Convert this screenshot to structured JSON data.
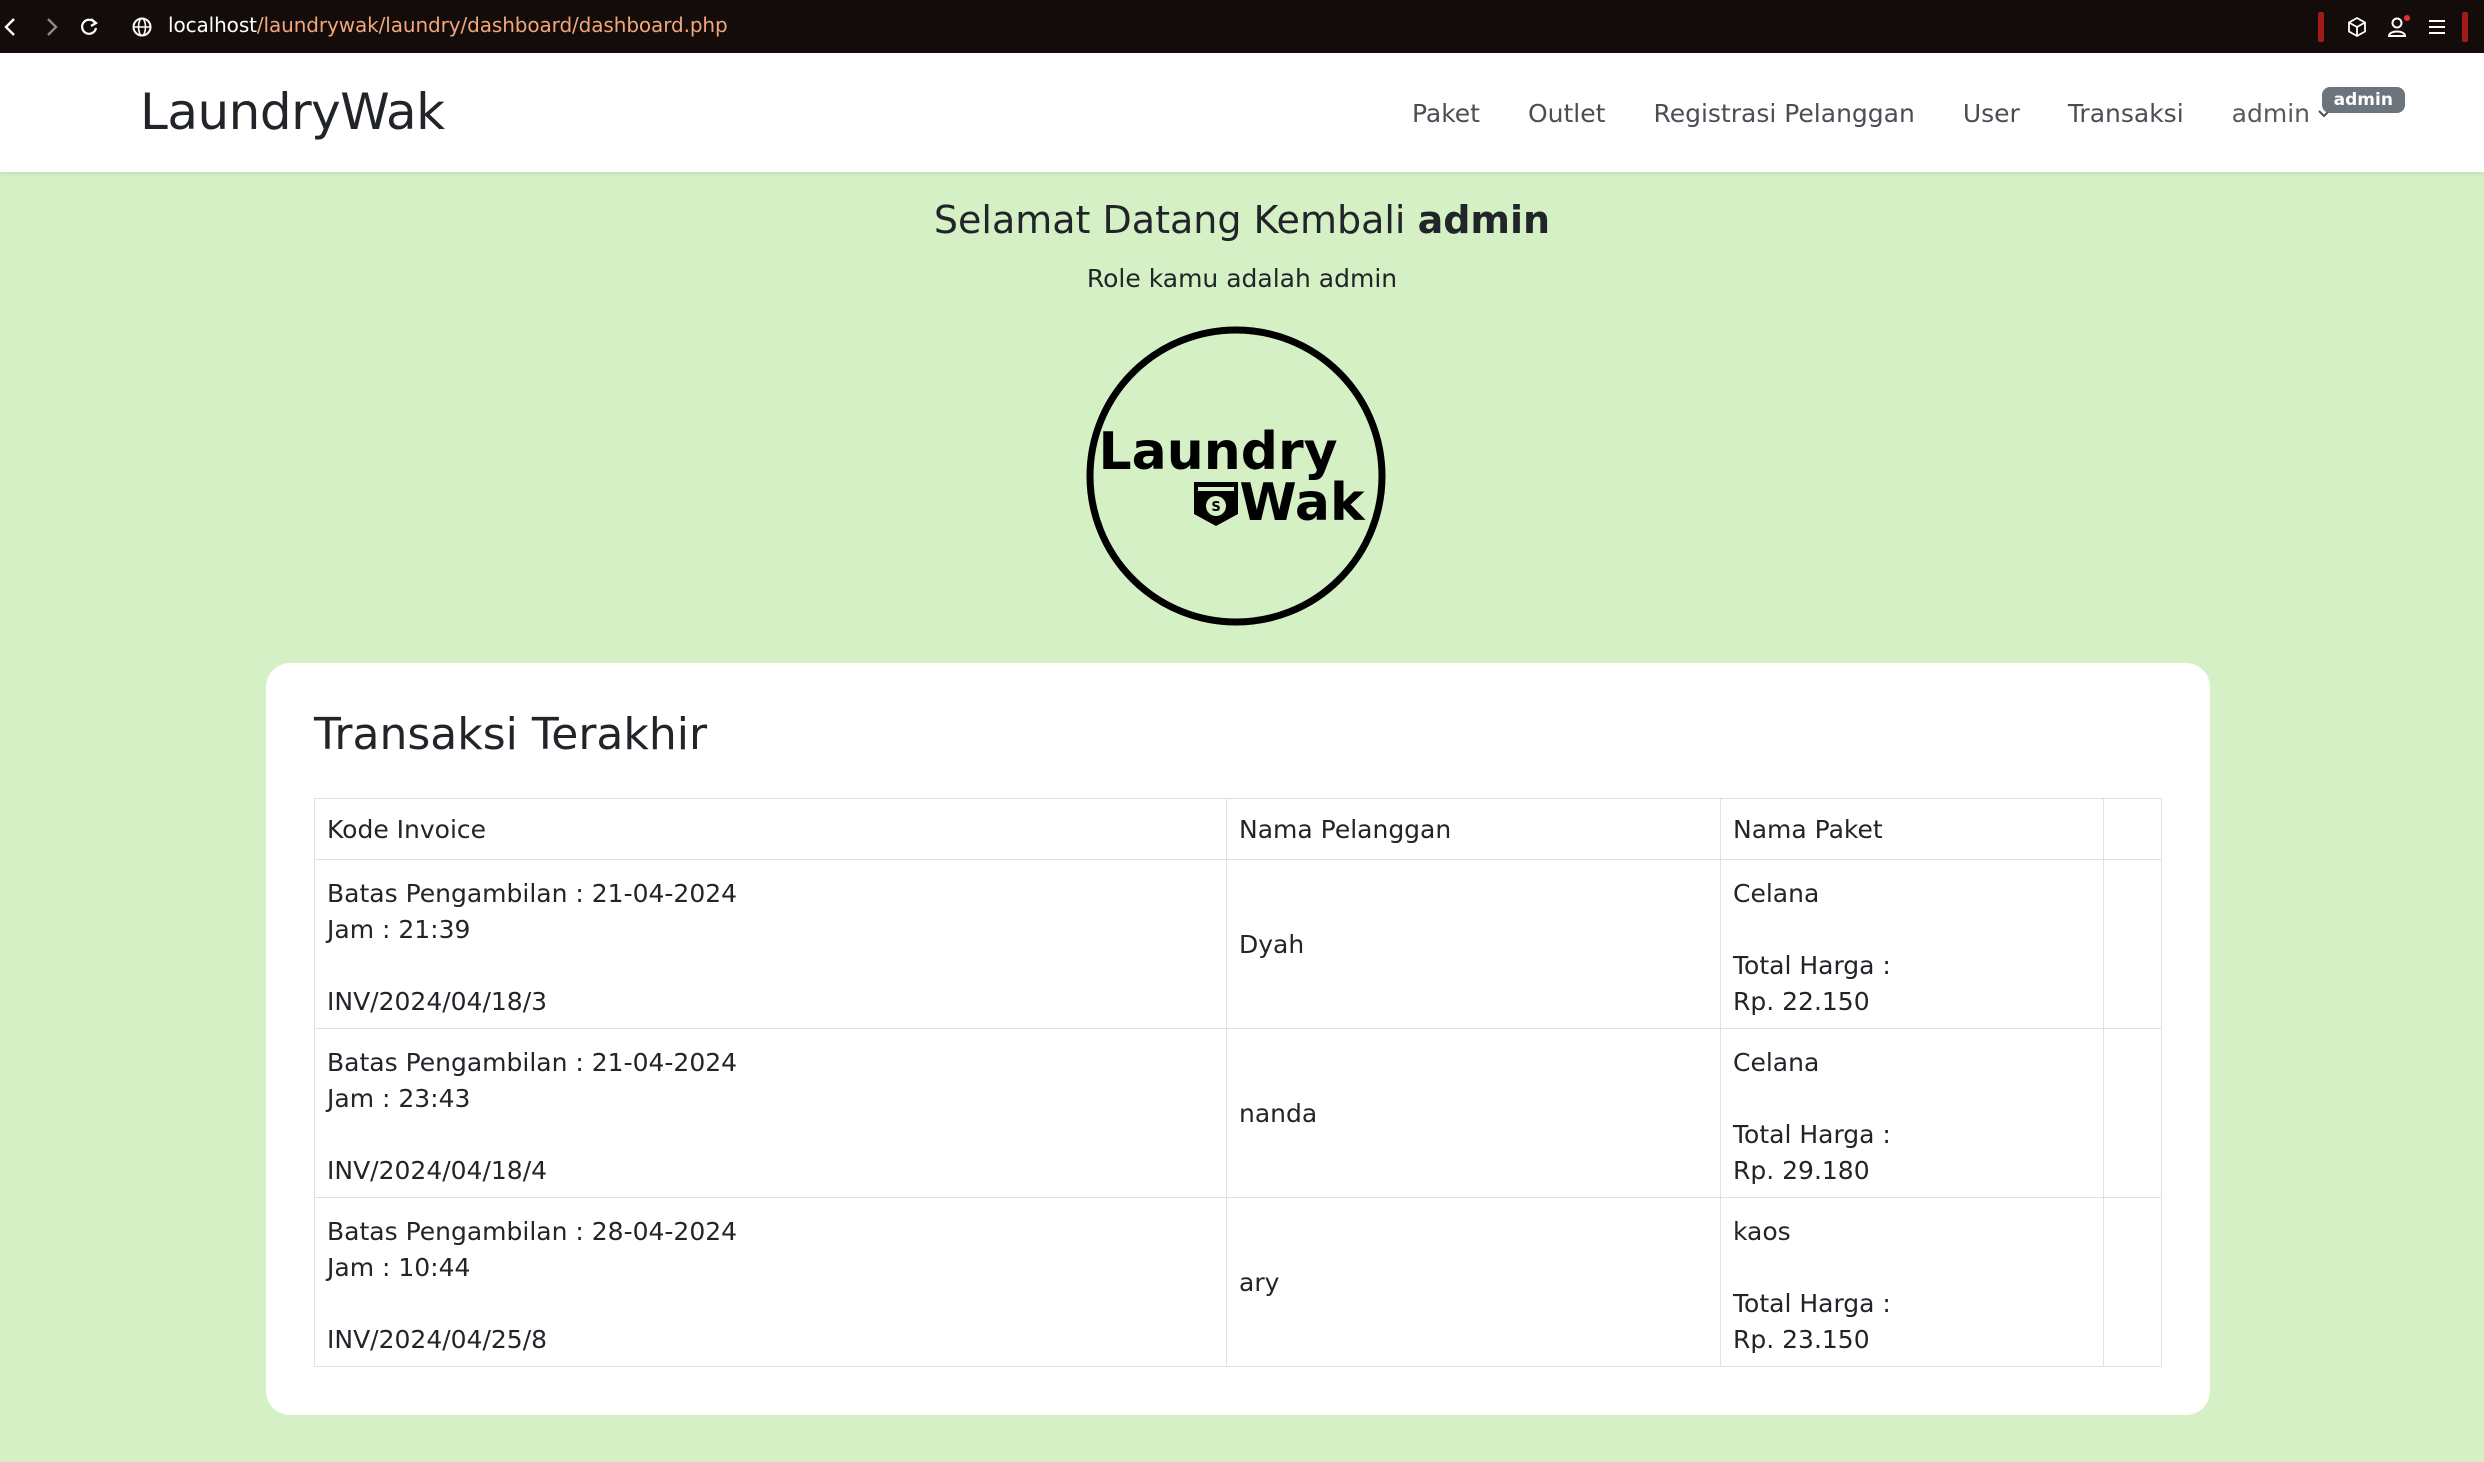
{
  "browser": {
    "url_host": "localhost",
    "url_path": "/laundrywak/laundry/dashboard/dashboard.php"
  },
  "navbar": {
    "brand": "LaundryWak",
    "menu": [
      "Paket",
      "Outlet",
      "Registrasi Pelanggan",
      "User",
      "Transaksi"
    ],
    "user_label": "admin",
    "badge": "admin"
  },
  "welcome": {
    "greeting": "Selamat Datang Kembali",
    "username": "admin",
    "role_text": "Role kamu adalah admin"
  },
  "logo": {
    "line1": "Laundry",
    "line2": "Wak",
    "mark": "S"
  },
  "transactions": {
    "title": "Transaksi Terakhir",
    "headers": [
      "Kode Invoice",
      "Nama Pelanggan",
      "Nama Paket",
      ""
    ],
    "rows": [
      {
        "batas": "Batas Pengambilan : 21-04-2024",
        "jam": "Jam : 21:39",
        "invoice": "INV/2024/04/18/3",
        "pelanggan": "Dyah",
        "paket": "Celana",
        "total_label": "Total Harga :",
        "total": "Rp. 22.150"
      },
      {
        "batas": "Batas Pengambilan : 21-04-2024",
        "jam": "Jam : 23:43",
        "invoice": "INV/2024/04/18/4",
        "pelanggan": "nanda",
        "paket": "Celana",
        "total_label": "Total Harga :",
        "total": "Rp. 29.180"
      },
      {
        "batas": "Batas Pengambilan : 28-04-2024",
        "jam": "Jam : 10:44",
        "invoice": "INV/2024/04/25/8",
        "pelanggan": "ary",
        "paket": "kaos",
        "total_label": "Total Harga :",
        "total": "Rp. 23.150"
      }
    ]
  },
  "icons": {
    "back": "arrow-left-icon",
    "forward": "arrow-right-icon",
    "reload": "reload-icon",
    "site": "globe-icon",
    "extensions": "cube-icon",
    "profile": "person-icon",
    "menu": "menu-icon",
    "caret": "chevron-down-icon"
  },
  "colors": {
    "page_bg": "#d4f0c4",
    "browser_bar": "#140c0a",
    "url_path": "#f0a77a",
    "badge": "#6c757d"
  }
}
